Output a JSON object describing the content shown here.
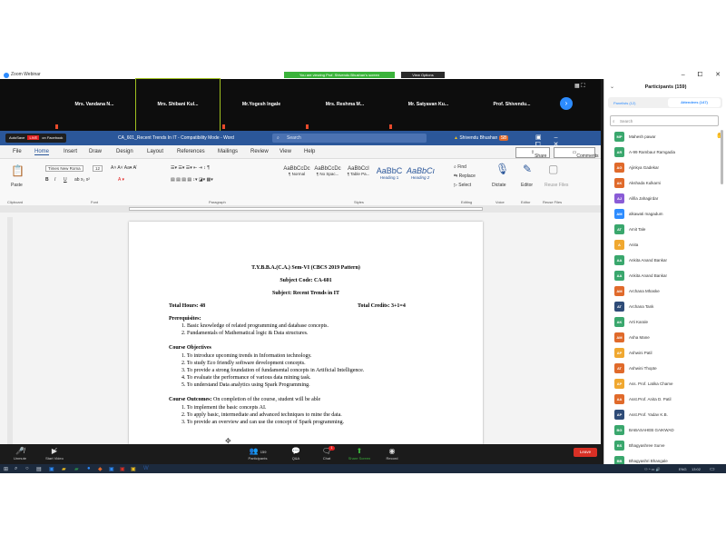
{
  "zoom": {
    "window_title": "Zoom Webinar",
    "view_banner": "You are viewing Prof. Shivendu Bhushan's screen",
    "view_options": "View Options",
    "win_controls": [
      "–",
      "⧠",
      "✕"
    ],
    "thumbnails": [
      {
        "name": "Mrs. Vandana N..."
      },
      {
        "name": "Mrs. Shibani Kul..."
      },
      {
        "name": "Mr.Yogesh Ingale"
      },
      {
        "name": "Mrs. Reshma M..."
      },
      {
        "name": "Mr. Satyavan Ku..."
      },
      {
        "name": "Prof. Shivendu..."
      }
    ],
    "controls": {
      "unmute": "Unmute",
      "start_video": "Start Video",
      "participants": "Participants",
      "participants_count": "159",
      "qa": "Q&A",
      "chat": "Chat",
      "share_screen": "Share Screen",
      "record": "Record",
      "leave": "Leave",
      "chat_badge": "1"
    }
  },
  "word": {
    "doc_title": "CA_601_Recent Trends In IT - Compatibility Mode - Word",
    "search": "Search",
    "user": "Shivendu Bhushan",
    "user_initials": "SB",
    "share_indicator": {
      "autosave": "AutoSave",
      "live": "LIVE",
      "facebook": "on Facebook"
    },
    "tabs": [
      "File",
      "Home",
      "Insert",
      "Draw",
      "Design",
      "Layout",
      "References",
      "Mailings",
      "Review",
      "View",
      "Help"
    ],
    "share": "Share",
    "comments": "Comments",
    "ribbon": {
      "paste": "Paste",
      "font_name": "Times New Roma",
      "font_size": "12",
      "groups": [
        "Clipboard",
        "Font",
        "Paragraph",
        "Styles",
        "Editing",
        "Voice",
        "Editor",
        "Reuse Files"
      ],
      "styles": [
        {
          "sample": "AaBbCcDc",
          "name": "¶ Normal"
        },
        {
          "sample": "AaBbCcDc",
          "name": "¶ No Spac..."
        },
        {
          "sample": "AaBbCcI",
          "name": "¶ Table Pa..."
        },
        {
          "sample": "AaBbC",
          "name": "Heading 1"
        },
        {
          "sample": "AaBbCı",
          "name": "Heading 2"
        }
      ],
      "find": "Find",
      "replace": "Replace",
      "select": "Select",
      "dictate": "Dictate",
      "editor": "Editor",
      "reuse": "Reuse Files"
    },
    "document": {
      "heading1": "T.Y.B.B.A.(C.A.) Sem-VI (CBCS 2019 Pattern)",
      "heading2": "Subject Code: CA-601",
      "heading3": "Subject: Recent Trends in IT",
      "total_hours": "Total Hours: 48",
      "total_credits": "Total Credits: 3+1=4",
      "prereq_title": "Prerequisites:",
      "prereqs": [
        "1.  Basic knowledge of related programming and database concepts.",
        "2.  Fundamentals of Mathematical logic & Data structures."
      ],
      "objectives_title": "Course Objectives",
      "objectives": [
        "1.  To introduce upcoming trends in Information technology.",
        "2.  To study Eco friendly software development concepts.",
        "3.  To provide a strong foundation of fundamental concepts in Artificial Intelligence.",
        "4.  To evaluate the performance of various data mining task.",
        "5.  To understand Data analytics using Spark Programming."
      ],
      "outcomes_title": "Course Outcomes:",
      "outcomes_intro": "On completion of the course, student will be able",
      "outcomes": [
        "1.  To implement the basic concepts AI.",
        "2.  To apply basic, intermediate and advanced techniques to mine the data.",
        "3.  To provide an overview and can use  the concept of Spark programming."
      ]
    }
  },
  "participants": {
    "title": "Participants (159)",
    "tab_panelists": "Panelists (12)",
    "tab_attendees": "Attendees (147)",
    "search_placeholder": "Search",
    "list": [
      {
        "initials": "MP",
        "name": "Mahesh pawar",
        "color": "#3aa76d",
        "hand": true
      },
      {
        "initials": "AR",
        "name": "A-99 Rambaur Ramgadia",
        "color": "#3aa76d"
      },
      {
        "initials": "AG",
        "name": "Ajinkya Gadekar",
        "color": "#e06a2b"
      },
      {
        "initials": "AK",
        "name": "Akshada Kulkarni",
        "color": "#e06a2b"
      },
      {
        "initials": "AJ",
        "name": "Alifia Jahagirdar",
        "color": "#8a5cd6"
      },
      {
        "initials": "AM",
        "name": "alkawati magadum",
        "color": "#2d8cff"
      },
      {
        "initials": "AT",
        "name": "Amit Tale",
        "color": "#3aa76d"
      },
      {
        "initials": "A",
        "name": "Anita",
        "color": "#f0a830"
      },
      {
        "initials": "AA",
        "name": "Ankita Anand Bankar",
        "color": "#3aa76d"
      },
      {
        "initials": "AA",
        "name": "Ankita Anand Bankar",
        "color": "#3aa76d"
      },
      {
        "initials": "AM",
        "name": "Archana Mhaske",
        "color": "#e06a2b"
      },
      {
        "initials": "AT",
        "name": "Archana Tank",
        "color": "#2f4c78"
      },
      {
        "initials": "AK",
        "name": "Arti Karale",
        "color": "#3aa76d"
      },
      {
        "initials": "AM",
        "name": "Asha Mane",
        "color": "#e06a2b"
      },
      {
        "initials": "AP",
        "name": "Ashwini Patil",
        "color": "#f0a830"
      },
      {
        "initials": "AT",
        "name": "Ashwini Thopte",
        "color": "#e06a2b"
      },
      {
        "initials": "AP",
        "name": "Ass. Prof. Latika Chame",
        "color": "#f0a830"
      },
      {
        "initials": "AA",
        "name": "Asst.Prof. Anita D. Patil",
        "color": "#e06a2b"
      },
      {
        "initials": "AP",
        "name": "Asst.Prof. Yadav K.B.",
        "color": "#2f4c78"
      },
      {
        "initials": "BG",
        "name": "BABASAHEB GAIKWAD",
        "color": "#3aa76d"
      },
      {
        "initials": "BS",
        "name": "Bhagyashree Surve",
        "color": "#3aa76d"
      },
      {
        "initials": "BB",
        "name": "Bhagyashri Bhangale",
        "color": "#3aa76d"
      }
    ]
  },
  "taskbar": {
    "lang": "ENG",
    "time": "13:02"
  }
}
